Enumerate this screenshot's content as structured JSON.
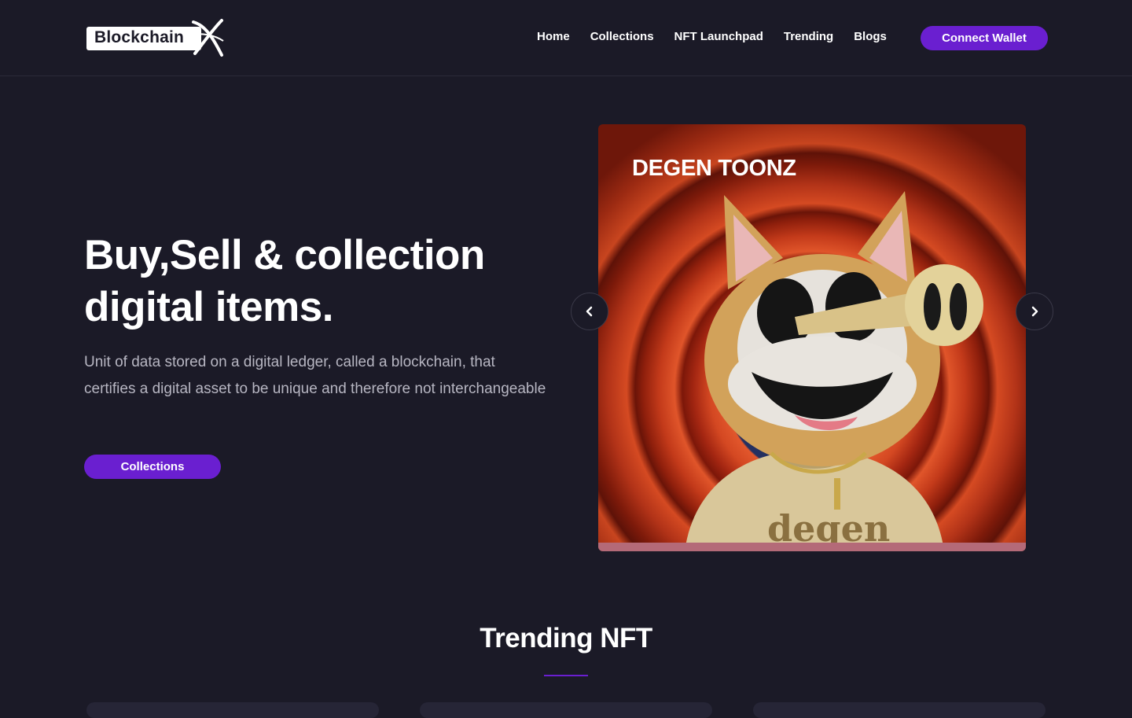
{
  "header": {
    "logo_text": "Blockchain",
    "nav": [
      "Home",
      "Collections",
      "NFT Launchpad",
      "Trending",
      "Blogs"
    ],
    "connect_label": "Connect Wallet"
  },
  "hero": {
    "title_line1": "Buy,Sell & collection",
    "title_line2": "digital items.",
    "description": "Unit of data stored on a digital ledger, called a blockchain, that certifies a digital asset to be unique and therefore not interchangeable",
    "button_label": "Collections"
  },
  "carousel": {
    "slide_title": "DEGEN TOONZ",
    "prev_icon": "chevron-left-icon",
    "next_icon": "chevron-right-icon"
  },
  "trending": {
    "title": "Trending NFT"
  },
  "colors": {
    "background": "#1b1a27",
    "accent": "#6a1fd0",
    "text_muted": "#b7b6c2"
  }
}
